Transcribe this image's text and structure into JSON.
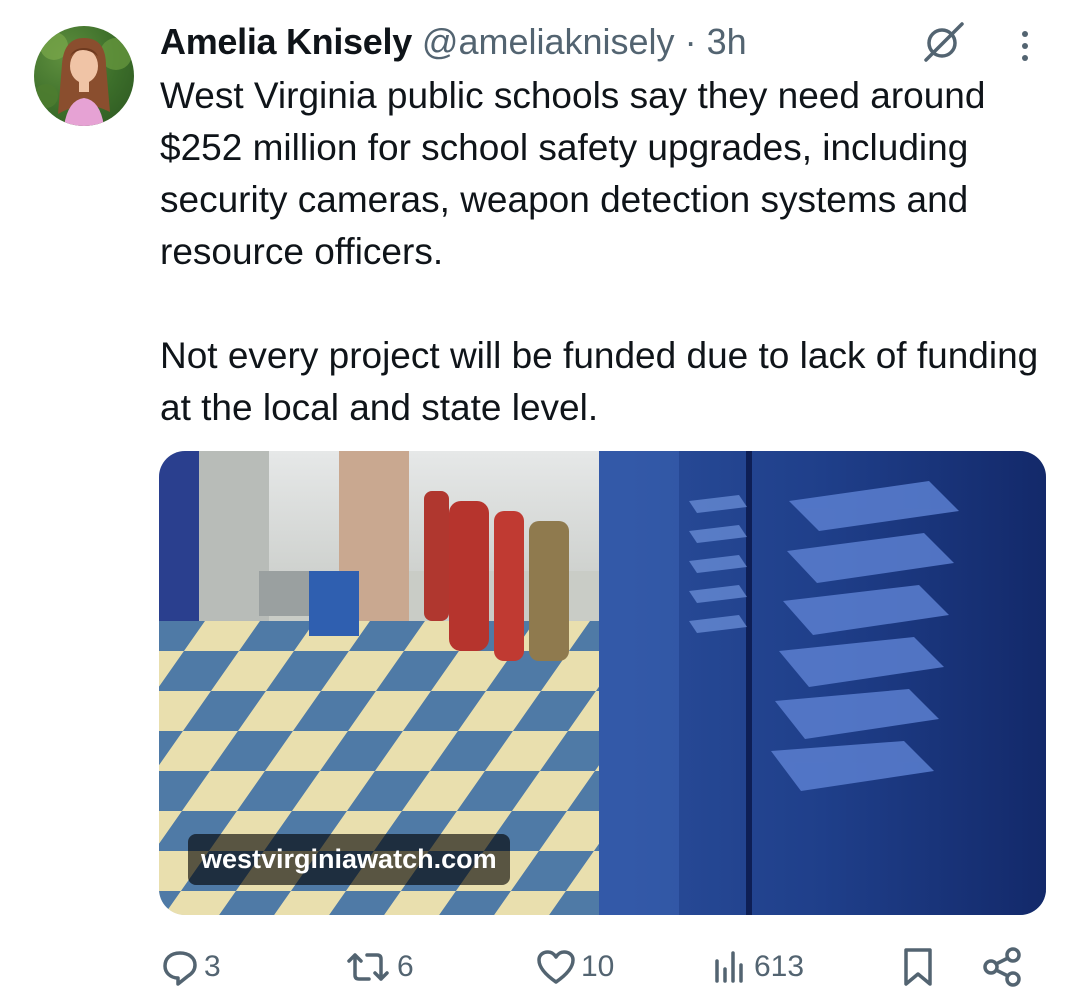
{
  "author": {
    "display_name": "Amelia Knisely",
    "handle": "@ameliaknisely",
    "separator": "·",
    "time": "3h",
    "avatar_icon": "profile-photo"
  },
  "tweet": {
    "paragraphs": [
      "West Virginia public schools say they need around $252 million for school safety upgrades, including security cameras, weapon detection systems and resource officers.",
      "Not every project will be funded due to lack of funding at the local and state level."
    ]
  },
  "media": {
    "link_label": "westvirginiawatch.com",
    "image_icon": "school-hallway-lockers-photo"
  },
  "actions": {
    "reply_count": "3",
    "retweet_count": "6",
    "like_count": "10",
    "views_count": "613",
    "icons": [
      "reply-icon",
      "retweet-icon",
      "like-icon",
      "views-icon",
      "bookmark-icon",
      "share-icon"
    ]
  },
  "colors": {
    "text": "#0f1419",
    "secondary": "#536471",
    "background": "#ffffff"
  }
}
